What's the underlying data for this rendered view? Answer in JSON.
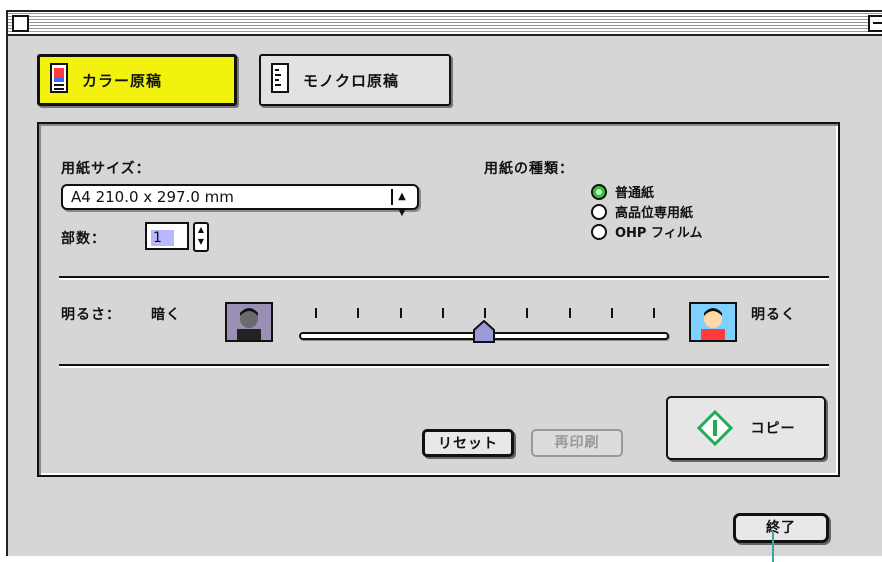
{
  "tabs": {
    "color_label": "カラー原稿",
    "mono_label": "モノクロ原稿"
  },
  "paper": {
    "size_label": "用紙サイズ：",
    "size_value": "A4 210.0 x 297.0 mm",
    "copies_label": "部数：",
    "copies_value": "1",
    "type_label": "用紙の種類：",
    "types": [
      {
        "label": "普通紙",
        "selected": true
      },
      {
        "label": "高品位専用紙",
        "selected": false
      },
      {
        "label": "OHP フィルム",
        "selected": false
      }
    ]
  },
  "brightness": {
    "label": "明るさ：",
    "dark_label": "暗く",
    "light_label": "明るく",
    "level": 0.5,
    "steps": 9
  },
  "buttons": {
    "reset": "リセット",
    "reprint": "再印刷",
    "copy": "コピー",
    "exit": "終了"
  },
  "colors": {
    "active_tab": "#f2f20e",
    "radio_selected": "#37c337",
    "copy_icon": "#22aa55"
  }
}
